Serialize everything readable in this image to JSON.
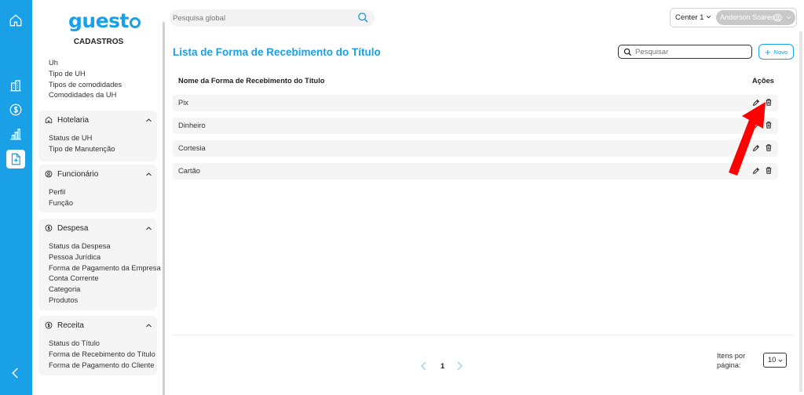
{
  "brand": {
    "logo_text": "guest",
    "section_title": "CADASTROS"
  },
  "rail": {
    "icons": [
      "home-icon",
      "building-icon",
      "dollar-icon",
      "bar-chart-icon",
      "document-add-icon",
      "chevron-left-icon"
    ],
    "active": "document-add-icon",
    "accent": "#1aa0e6"
  },
  "sidebar": {
    "top_items": [
      "Uh",
      "Tipo de UH",
      "Tipos de comodidades",
      "Comodidades da UH"
    ],
    "groups": [
      {
        "title": "Hotelaria",
        "icon": "home-icon",
        "items": [
          "Status de UH",
          "Tipo de Manutenção"
        ]
      },
      {
        "title": "Funcionário",
        "icon": "user-circle-icon",
        "items": [
          "Perfil",
          "Função"
        ]
      },
      {
        "title": "Despesa",
        "icon": "dollar-circle-icon",
        "items": [
          "Status da Despesa",
          "Pessoa Jurídica",
          "Forma de Pagamento da Empresa",
          "Conta Corrente",
          "Categoria",
          "Produtos"
        ]
      },
      {
        "title": "Receita",
        "icon": "dollar-circle-icon",
        "items": [
          "Status do Título",
          "Forma de Recebimento do Título",
          "Forma de Pagamento do Cliente"
        ]
      }
    ]
  },
  "topbar": {
    "global_search_placeholder": "Pesquisa global",
    "center": "Center 1",
    "user": "Anderson Soares"
  },
  "main": {
    "title": "Lista de Forma de Recebimento do Título",
    "search_placeholder": "Pesquisar",
    "new_label": "Novo",
    "columns": {
      "name": "Nome da Forma de Recebimento do Título",
      "actions": "Ações"
    },
    "rows": [
      "Pix",
      "Dinheiro",
      "Cortesia",
      "Cartão"
    ]
  },
  "pagination": {
    "current_page": "1",
    "items_per_page_label": "Itens por página:",
    "items_per_page": "10"
  },
  "colors": {
    "accent": "#1aa0e6",
    "row_bg": "#f5f5f5",
    "annotation_arrow": "#ff0000"
  }
}
